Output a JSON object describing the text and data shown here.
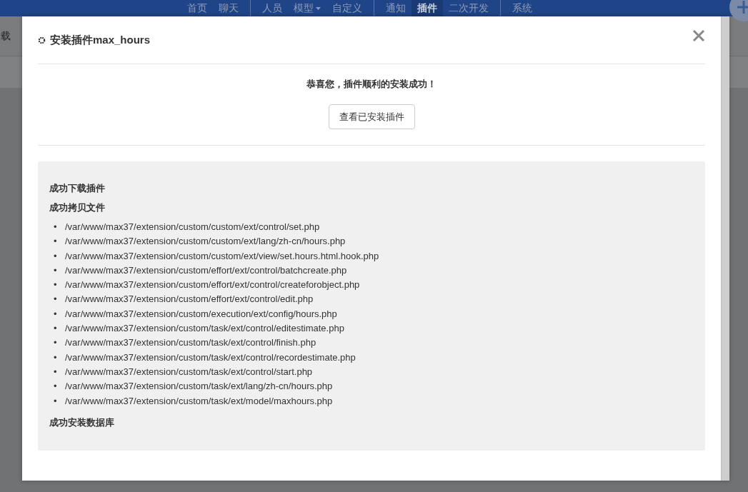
{
  "nav": {
    "groups": [
      [
        {
          "label": "首页",
          "selected": false
        },
        {
          "label": "聊天",
          "selected": false
        }
      ],
      [
        {
          "label": "人员",
          "selected": false
        },
        {
          "label": "模型",
          "selected": false,
          "dropdown": true
        },
        {
          "label": "自定义",
          "selected": false
        }
      ],
      [
        {
          "label": "通知",
          "selected": false
        },
        {
          "label": "插件",
          "selected": true
        },
        {
          "label": "二次开发",
          "selected": false
        }
      ],
      [
        {
          "label": "系统",
          "selected": false
        }
      ]
    ]
  },
  "page_fragment": "载",
  "dialog": {
    "title": "安装插件max_hours",
    "message": "恭喜您，插件顺利的安装成功！",
    "button": "查看已安装插件",
    "log": [
      {
        "kind": "heading",
        "text": "成功下载插件"
      },
      {
        "kind": "heading",
        "text": "成功拷贝文件"
      },
      {
        "kind": "files",
        "bullet": "•",
        "items": [
          "/var/www/max37/extension/custom/custom/ext/control/set.php",
          "/var/www/max37/extension/custom/custom/ext/lang/zh-cn/hours.php",
          "/var/www/max37/extension/custom/custom/ext/view/set.hours.html.hook.php",
          "/var/www/max37/extension/custom/effort/ext/control/batchcreate.php",
          "/var/www/max37/extension/custom/effort/ext/control/createforobject.php",
          "/var/www/max37/extension/custom/effort/ext/control/edit.php",
          "/var/www/max37/extension/custom/execution/ext/config/hours.php",
          "/var/www/max37/extension/custom/task/ext/control/editestimate.php",
          "/var/www/max37/extension/custom/task/ext/control/finish.php",
          "/var/www/max37/extension/custom/task/ext/control/recordestimate.php",
          "/var/www/max37/extension/custom/task/ext/control/start.php",
          "/var/www/max37/extension/custom/task/ext/lang/zh-cn/hours.php",
          "/var/www/max37/extension/custom/task/ext/model/maxhours.php"
        ]
      },
      {
        "kind": "heading",
        "text": "成功安装数据库"
      }
    ]
  }
}
